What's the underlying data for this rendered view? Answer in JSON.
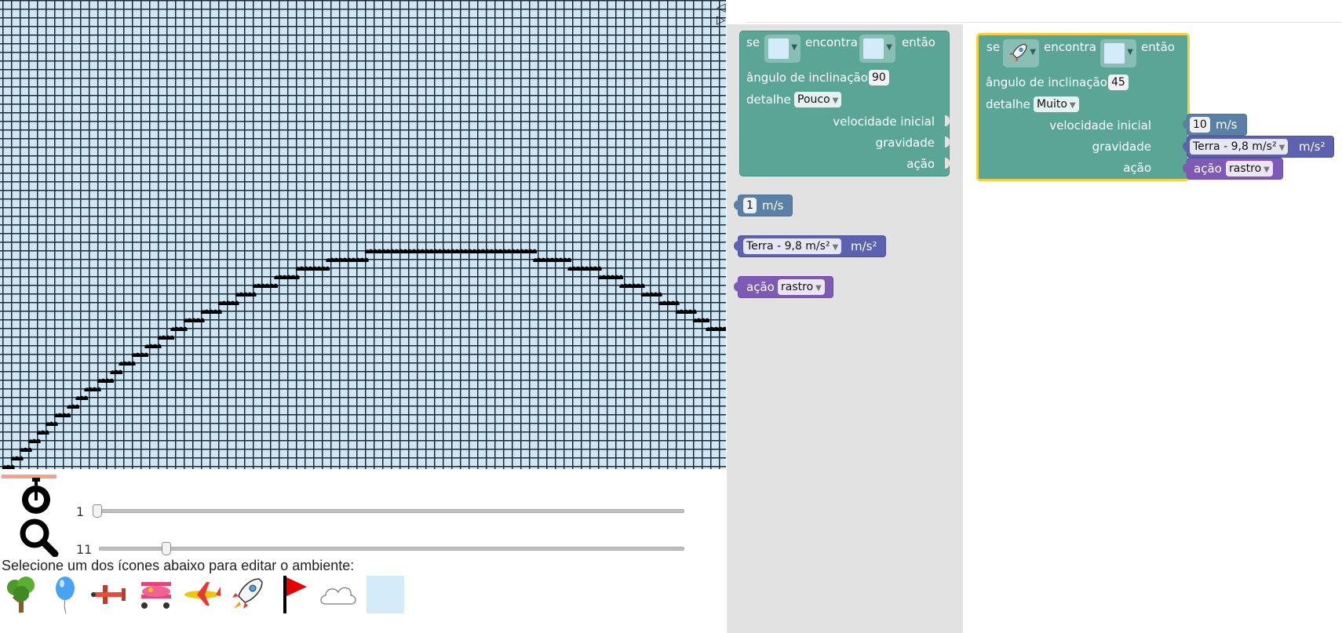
{
  "stage": {
    "nav_prev_icon": "triangle-left-icon",
    "nav_next_icon": "triangle-right-icon",
    "trail_icon": "cloud-puff-icon"
  },
  "controls": {
    "speed": {
      "icon": "stopwatch-icon",
      "value": "1",
      "position": 0.0
    },
    "zoom": {
      "icon": "magnifier-icon",
      "value": "11",
      "position": 0.11
    }
  },
  "palette": {
    "label": "Selecione um dos ícones abaixo para editar o ambiente:",
    "items": [
      "tree-icon",
      "balloon-icon",
      "biplane-icon",
      "pink-plane-icon",
      "jet-icon",
      "rocket-icon",
      "flag-icon",
      "cloud-icon",
      "empty-tile-icon"
    ]
  },
  "flyout": {
    "if_block": {
      "se": "se",
      "encontra": "encontra",
      "entao": "então",
      "angle_label": "ângulo de inclinação",
      "angle_value": "90",
      "detail_label": "detalhe",
      "detail_value": "Pouco",
      "initial_speed_label": "velocidade inicial",
      "gravity_label": "gravidade",
      "action_label": "ação"
    },
    "speed_block": {
      "value": "1",
      "unit": "m/s"
    },
    "gravity_block": {
      "value": "Terra - 9,8 m/s²",
      "unit": "m/s²"
    },
    "action_block": {
      "label": "ação",
      "value": "rastro"
    }
  },
  "workspace": {
    "if_block": {
      "se": "se",
      "encontra": "encontra",
      "entao": "então",
      "object_icon": "rocket-icon",
      "angle_label": "ângulo de inclinação",
      "angle_value": "45",
      "detail_label": "detalhe",
      "detail_value": "Muito",
      "initial_speed_label": "velocidade inicial",
      "gravity_label": "gravidade",
      "action_label": "ação"
    },
    "speed_block": {
      "value": "10",
      "unit": "m/s"
    },
    "gravity_block": {
      "value": "Terra - 9,8 m/s²",
      "unit": "m/s²"
    },
    "action_block": {
      "label": "ação",
      "value": "rastro"
    }
  }
}
